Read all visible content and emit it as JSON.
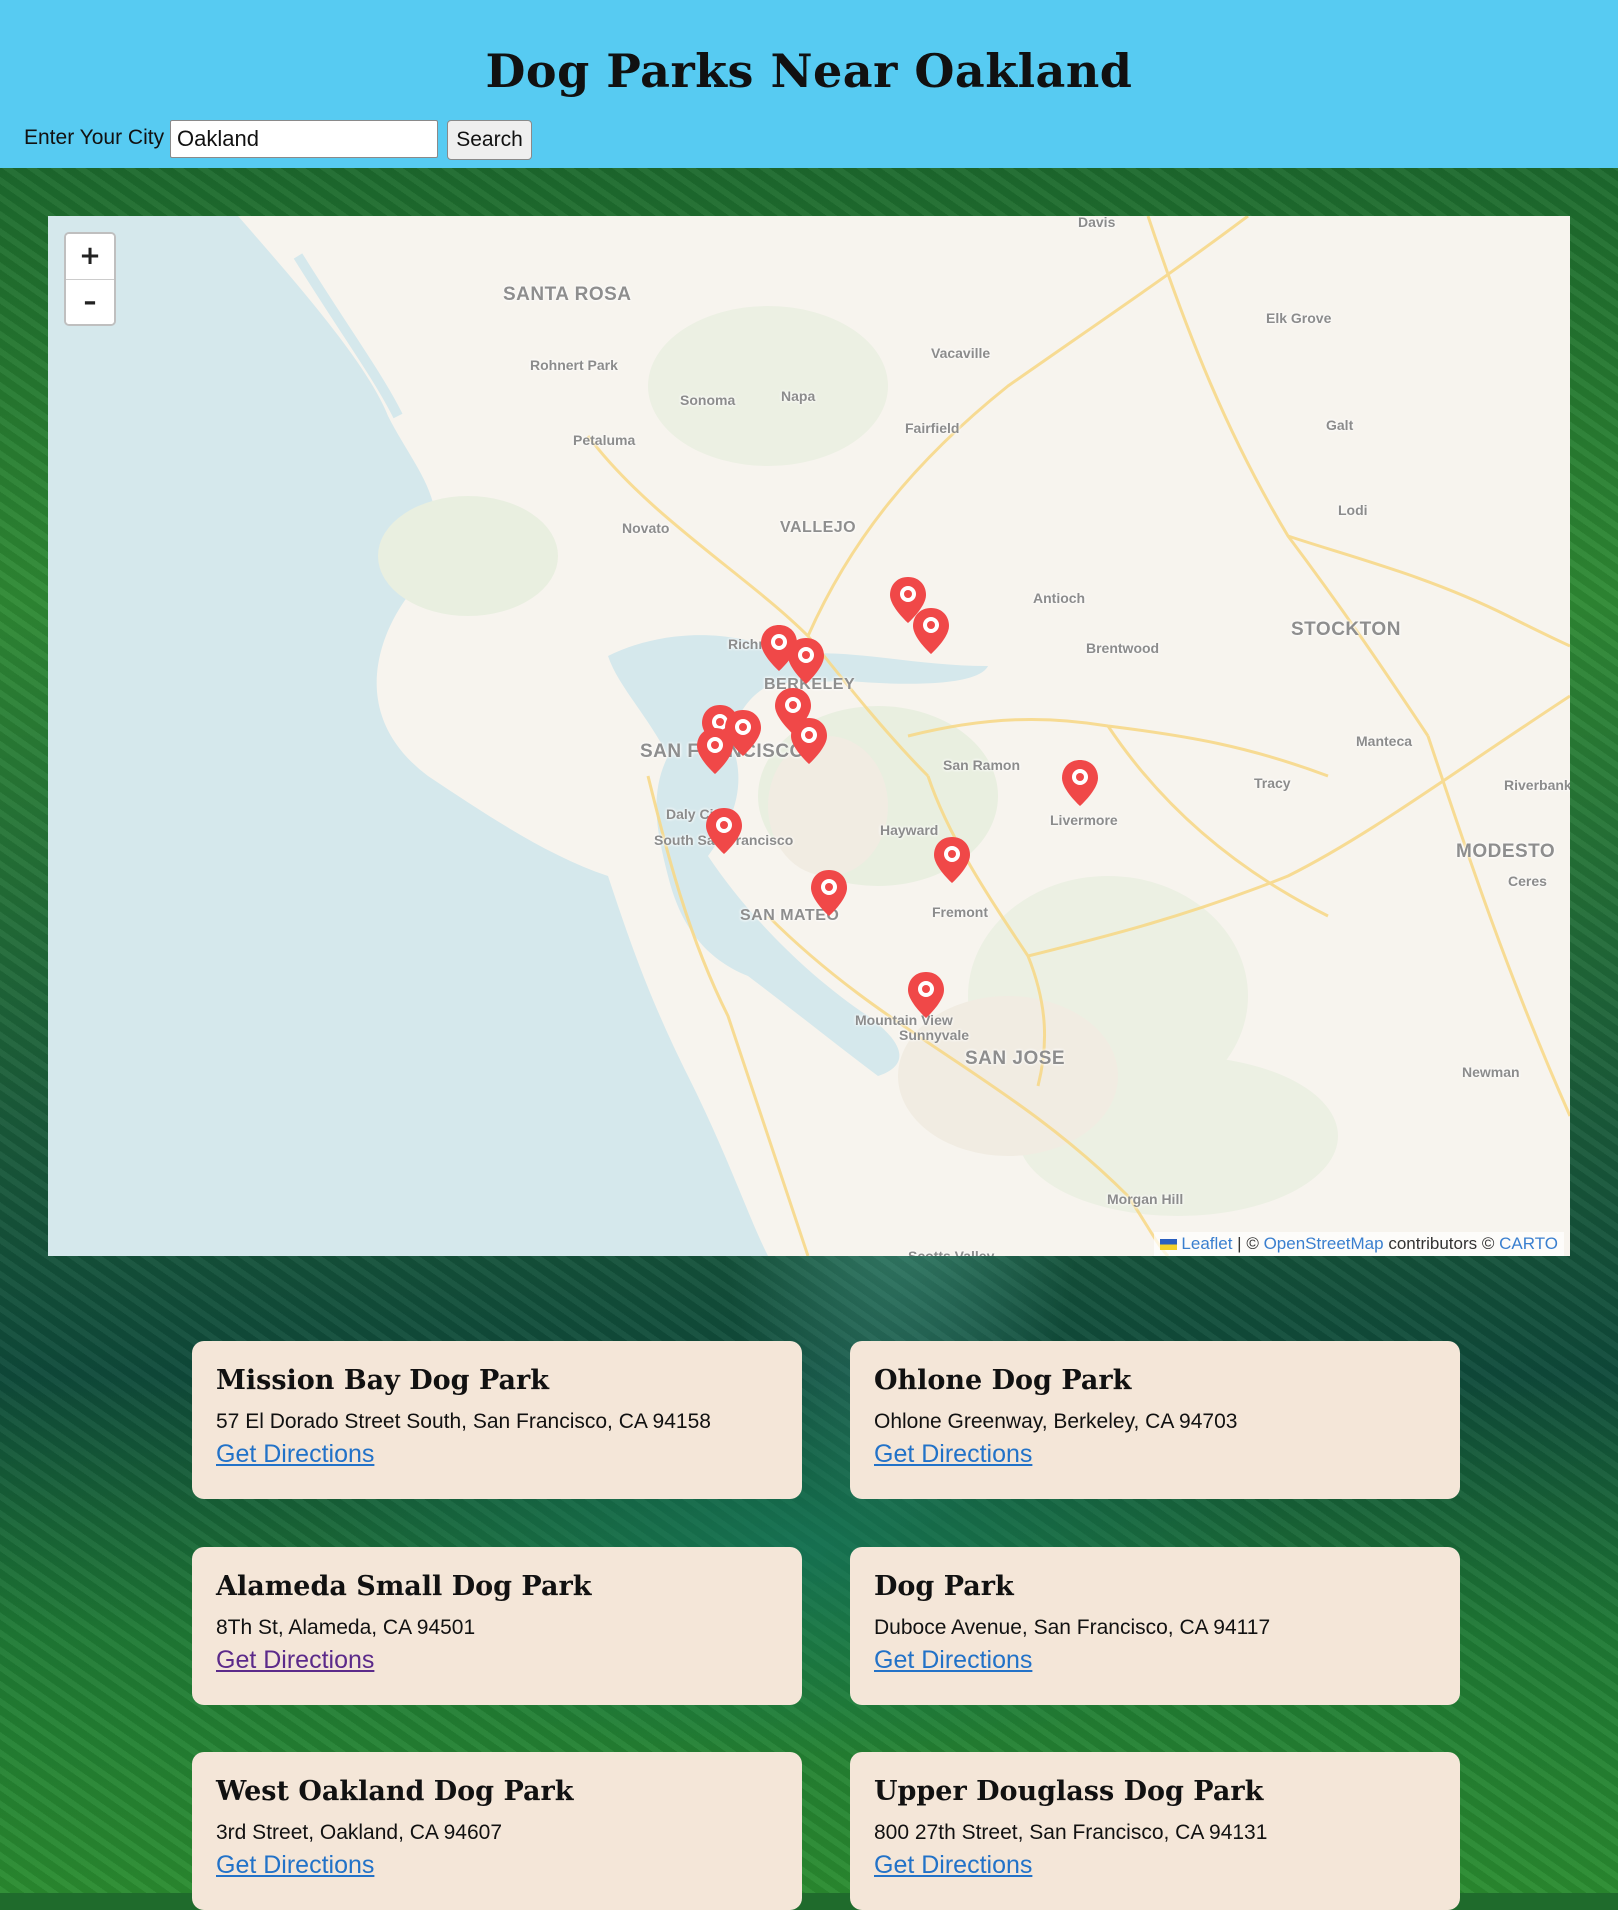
{
  "page": {
    "title": "Dog Parks Near Oakland",
    "city_label": "Enter Your City",
    "city_value": "Oakland",
    "search_label": "Search"
  },
  "map": {
    "zoom_in": "+",
    "zoom_out": "–",
    "attribution": {
      "leaflet": "Leaflet",
      "sep1": " | © ",
      "osm": "OpenStreetMap",
      "contributors": " contributors © ",
      "carto": "CARTO"
    },
    "places": {
      "santa_rosa": "SANTA ROSA",
      "davis": "Davis",
      "elk_grove": "Elk Grove",
      "rohnert_park": "Rohnert Park",
      "vacaville": "Vacaville",
      "sonoma": "Sonoma",
      "napa": "Napa",
      "fairfield": "Fairfield",
      "galt": "Galt",
      "petaluma": "Petaluma",
      "lodi": "Lodi",
      "novato": "Novato",
      "vallejo": "VALLEJO",
      "antioch": "Antioch",
      "stockton": "STOCKTON",
      "brentwood": "Brentwood",
      "richmond": "Richmond",
      "berkeley": "BERKELEY",
      "manteca": "Manteca",
      "san_francisco": "SAN FRANCISCO",
      "san_ramon": "San Ramon",
      "tracy": "Tracy",
      "riverbank": "Riverbank",
      "daly_city": "Daly City",
      "livermore": "Livermore",
      "south_sf": "South San Francisco",
      "hayward": "Hayward",
      "modesto": "MODESTO",
      "ceres": "Ceres",
      "san_mateo": "SAN MATEO",
      "fremont": "Fremont",
      "mountain_view": "Mountain View",
      "sunnyvale": "Sunnyvale",
      "san_jose": "SAN JOSE",
      "newman": "Newman",
      "morgan_hill": "Morgan Hill",
      "scotts_valley": "Scotts Valley"
    },
    "marker_icon": "map-pin-icon",
    "marker_color": "#f04848"
  },
  "parks": [
    {
      "name": "Mission Bay Dog Park",
      "address": "57 El Dorado Street South, San Francisco, CA 94158",
      "link": "Get Directions"
    },
    {
      "name": "Ohlone Dog Park",
      "address": "Ohlone Greenway, Berkeley, CA 94703",
      "link": "Get Directions"
    },
    {
      "name": "Alameda Small Dog Park",
      "address": "8Th St, Alameda, CA 94501",
      "link": "Get Directions"
    },
    {
      "name": "Dog Park",
      "address": "Duboce Avenue, San Francisco, CA 94117",
      "link": "Get Directions"
    },
    {
      "name": "West Oakland Dog Park",
      "address": "3rd Street, Oakland, CA 94607",
      "link": "Get Directions"
    },
    {
      "name": "Upper Douglass Dog Park",
      "address": "800 27th Street, San Francisco, CA 94131",
      "link": "Get Directions"
    }
  ],
  "colors": {
    "header_bg": "#57cbf2",
    "card_bg": "#f4e6d8",
    "link": "#2272c8",
    "link_visited": "#5b2a8a"
  }
}
